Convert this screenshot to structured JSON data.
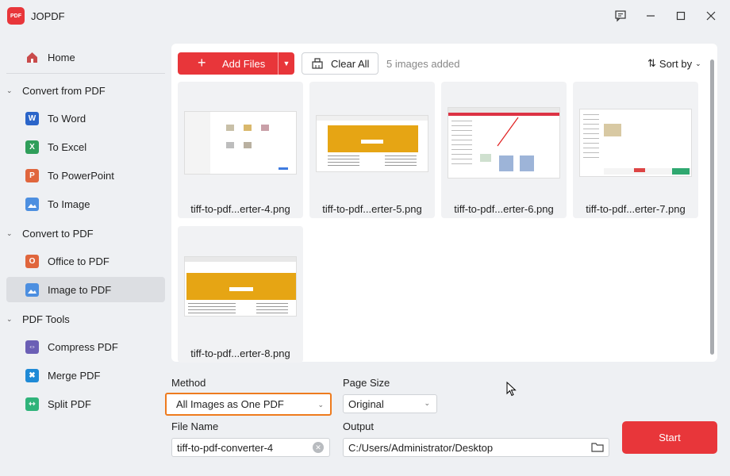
{
  "app": {
    "title": "JOPDF",
    "logo_text": "PDF"
  },
  "sidebar": {
    "home": "Home",
    "sections": [
      {
        "label": "Convert from PDF",
        "items": [
          "To Word",
          "To Excel",
          "To PowerPoint",
          "To Image"
        ]
      },
      {
        "label": "Convert to PDF",
        "items": [
          "Office to PDF",
          "Image to PDF"
        ]
      },
      {
        "label": "PDF Tools",
        "items": [
          "Compress PDF",
          "Merge PDF",
          "Split PDF"
        ]
      }
    ],
    "active_item": "Image to PDF"
  },
  "toolbar": {
    "add_files": "Add Files",
    "clear_all": "Clear All",
    "count_text": "5 images added",
    "sort_label": "Sort by"
  },
  "files": [
    {
      "name": "tiff-to-pdf...erter-4.png"
    },
    {
      "name": "tiff-to-pdf...erter-5.png"
    },
    {
      "name": "tiff-to-pdf...erter-6.png"
    },
    {
      "name": "tiff-to-pdf...erter-7.png"
    },
    {
      "name": "tiff-to-pdf...erter-8.png"
    }
  ],
  "form": {
    "method_label": "Method",
    "method_value": "All Images as One PDF",
    "page_size_label": "Page Size",
    "page_size_value": "Original",
    "file_name_label": "File Name",
    "file_name_value": "tiff-to-pdf-converter-4",
    "output_label": "Output",
    "output_value": "C:/Users/Administrator/Desktop",
    "start": "Start"
  },
  "colors": {
    "accent": "#e8363a",
    "highlight": "#ee7b1e",
    "active_bg": "#dcdee2"
  }
}
